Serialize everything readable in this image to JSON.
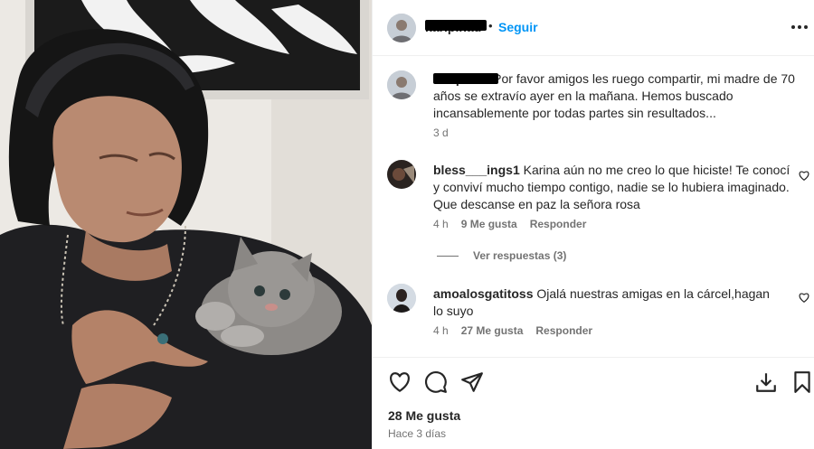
{
  "post": {
    "author_display": "karipinad",
    "follow_label": "Seguir",
    "more_icon": "more-options-icon",
    "caption": {
      "username": "karipinad",
      "text": "Por favor amigos les ruego compartir, mi madre de 70 años se extravío ayer en la mañana. Hemos buscado incansablemente por todas partes sin resultados...",
      "time": "3 d"
    }
  },
  "comments": [
    {
      "username": "bless___ings1",
      "text": "Karina aún no me creo lo que hiciste! Te conocí y conviví mucho tiempo contigo, nadie se lo hubiera imaginado. Que descanse en paz la señora rosa",
      "time": "4 h",
      "likes": "9 Me gusta",
      "reply": "Responder"
    },
    {
      "username": "amoalosgatitoss",
      "text": "Ojalá nuestras amigas en la cárcel,hagan lo suyo",
      "time": "4 h",
      "likes": "27 Me gusta",
      "reply": "Responder"
    }
  ],
  "view_replies": "Ver respuestas (3)",
  "actions": {
    "like_icon": "heart-icon",
    "comment_icon": "comment-icon",
    "share_icon": "share-icon",
    "save_icon": "bookmark-icon",
    "download_icon": "download-icon"
  },
  "likes_total": "28 Me gusta",
  "posted": "Hace 3 días",
  "colors": {
    "link": "#0095f6",
    "meta": "#737373",
    "text": "#262626"
  }
}
